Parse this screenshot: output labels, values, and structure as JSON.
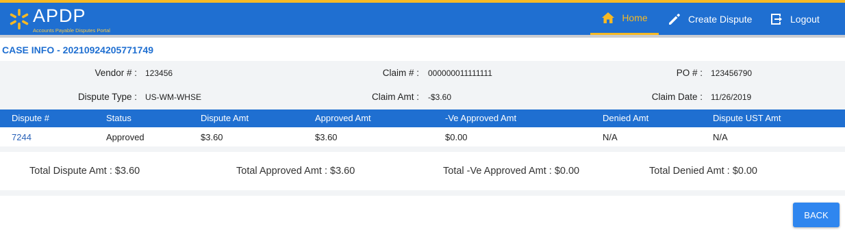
{
  "brand": {
    "title": "APDP",
    "subtitle": "Accounts Payable Disputes Portal"
  },
  "nav": {
    "home": "Home",
    "create": "Create Dispute",
    "logout": "Logout"
  },
  "case": {
    "title": "CASE INFO - 20210924205771749"
  },
  "info": {
    "vendor_label": "Vendor # :",
    "vendor_value": "123456",
    "claim_label": "Claim # :",
    "claim_value": "000000011111111",
    "po_label": "PO # :",
    "po_value": "123456790",
    "dtype_label": "Dispute Type :",
    "dtype_value": "US-WM-WHSE",
    "camt_label": "Claim Amt :",
    "camt_value": "-$3.60",
    "cdate_label": "Claim Date :",
    "cdate_value": "11/26/2019"
  },
  "table": {
    "headers": [
      "Dispute #",
      "Status",
      "Dispute Amt",
      "Approved Amt",
      "-Ve Approved Amt",
      "Denied Amt",
      "Dispute UST Amt"
    ],
    "rows": [
      [
        "7244",
        "Approved",
        "$3.60",
        "$3.60",
        "$0.00",
        "N/A",
        "N/A"
      ]
    ]
  },
  "totals": {
    "dispute": "Total Dispute Amt : $3.60",
    "approved": "Total Approved Amt : $3.60",
    "ve_approved": "Total -Ve Approved Amt : $0.00",
    "denied": "Total Denied Amt : $0.00"
  },
  "buttons": {
    "back": "BACK"
  },
  "colors": {
    "primary": "#1f6fd1",
    "accent": "#f7b924",
    "button": "#2f86ef"
  },
  "icons": {
    "brand": "spark-icon",
    "home": "home-icon",
    "create": "pencil-icon",
    "logout": "logout-icon"
  }
}
